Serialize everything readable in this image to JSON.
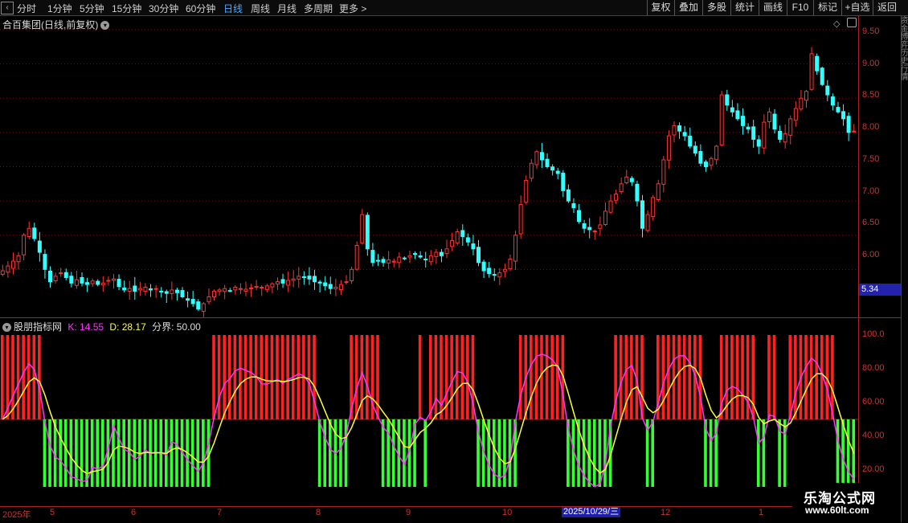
{
  "toolbar": {
    "back_icon": "‹",
    "periods": [
      "分时",
      "1分钟",
      "5分钟",
      "15分钟",
      "30分钟",
      "60分钟",
      "日线",
      "周线",
      "月线",
      "多周期",
      "更多 >"
    ],
    "active_period": "日线",
    "right_buttons": [
      "复权",
      "叠加",
      "多股",
      "统计",
      "画线",
      "F10",
      "标记",
      "+自选",
      "返回"
    ]
  },
  "main_chart": {
    "title": "合百集团(日线,前复权)",
    "current_price_label": "5.34",
    "price_ticks": [
      "9.50",
      "9.00",
      "8.50",
      "8.00",
      "7.50",
      "7.00",
      "6.50",
      "6.00"
    ],
    "colors": {
      "up": "#ff3333",
      "down": "#33ffff",
      "grid": "#7a1010"
    }
  },
  "indicator": {
    "name": "股朋指标网",
    "k_label": "K: 14.55",
    "d_label": "D: 28.17",
    "boundary_label": "分界: 50.00",
    "ticks": [
      "100.0",
      "80.00",
      "60.00",
      "40.00",
      "20.00"
    ],
    "colors": {
      "k": "#ff33ff",
      "d": "#ffff33",
      "red_bar": "#ff2222",
      "green_bar": "#33ff33"
    }
  },
  "x_axis": {
    "labels": [
      "2025年",
      "5",
      "6",
      "7",
      "8",
      "9",
      "10",
      "2025/10/29/三",
      "12",
      "1"
    ],
    "highlight_date": "2025/10/29/三"
  },
  "right_strip_text": "资金博弈历史行情",
  "watermark": {
    "line1": "乐淘公式网",
    "line2": "www.60lt.com"
  },
  "chart_data": {
    "type": "candlestick",
    "ylim": [
      5.3,
      9.7
    ],
    "closes": [
      5.98,
      6.05,
      6.12,
      6.2,
      6.5,
      6.6,
      6.45,
      6.25,
      6.0,
      5.82,
      5.9,
      5.95,
      5.88,
      5.8,
      5.85,
      5.8,
      5.78,
      5.83,
      5.78,
      5.8,
      5.84,
      5.86,
      5.75,
      5.7,
      5.72,
      5.68,
      5.72,
      5.74,
      5.7,
      5.72,
      5.68,
      5.65,
      5.7,
      5.66,
      5.6,
      5.55,
      5.5,
      5.42,
      5.5,
      5.6,
      5.68,
      5.7,
      5.72,
      5.69,
      5.74,
      5.72,
      5.71,
      5.73,
      5.75,
      5.74,
      5.76,
      5.79,
      5.82,
      5.8,
      5.84,
      5.86,
      5.9,
      5.88,
      5.86,
      5.82,
      5.8,
      5.76,
      5.72,
      5.74,
      5.78,
      5.82,
      6.0,
      6.35,
      6.8,
      6.3,
      6.1,
      6.12,
      6.1,
      6.14,
      6.12,
      6.18,
      6.16,
      6.2,
      6.22,
      6.18,
      6.15,
      6.2,
      6.25,
      6.2,
      6.3,
      6.42,
      6.55,
      6.48,
      6.4,
      6.3,
      6.1,
      5.98,
      5.94,
      5.92,
      5.95,
      6.0,
      6.15,
      6.5,
      6.95,
      7.3,
      7.55,
      7.72,
      7.6,
      7.5,
      7.45,
      7.4,
      7.15,
      7.0,
      6.9,
      6.7,
      6.6,
      6.58,
      6.56,
      6.65,
      6.85,
      7.0,
      7.1,
      7.25,
      7.35,
      7.28,
      7.0,
      6.6,
      6.8,
      7.05,
      7.25,
      7.6,
      7.95,
      8.1,
      8.02,
      7.95,
      7.8,
      7.7,
      7.55,
      7.5,
      7.62,
      7.8,
      8.55,
      8.4,
      8.3,
      8.2,
      8.1,
      8.05,
      7.9,
      7.8,
      8.15,
      8.3,
      8.05,
      7.9,
      7.98,
      8.2,
      8.35,
      8.5,
      8.6,
      9.15,
      8.9,
      8.7,
      8.55,
      8.4,
      8.3,
      8.2,
      8.0,
      8.02
    ]
  }
}
